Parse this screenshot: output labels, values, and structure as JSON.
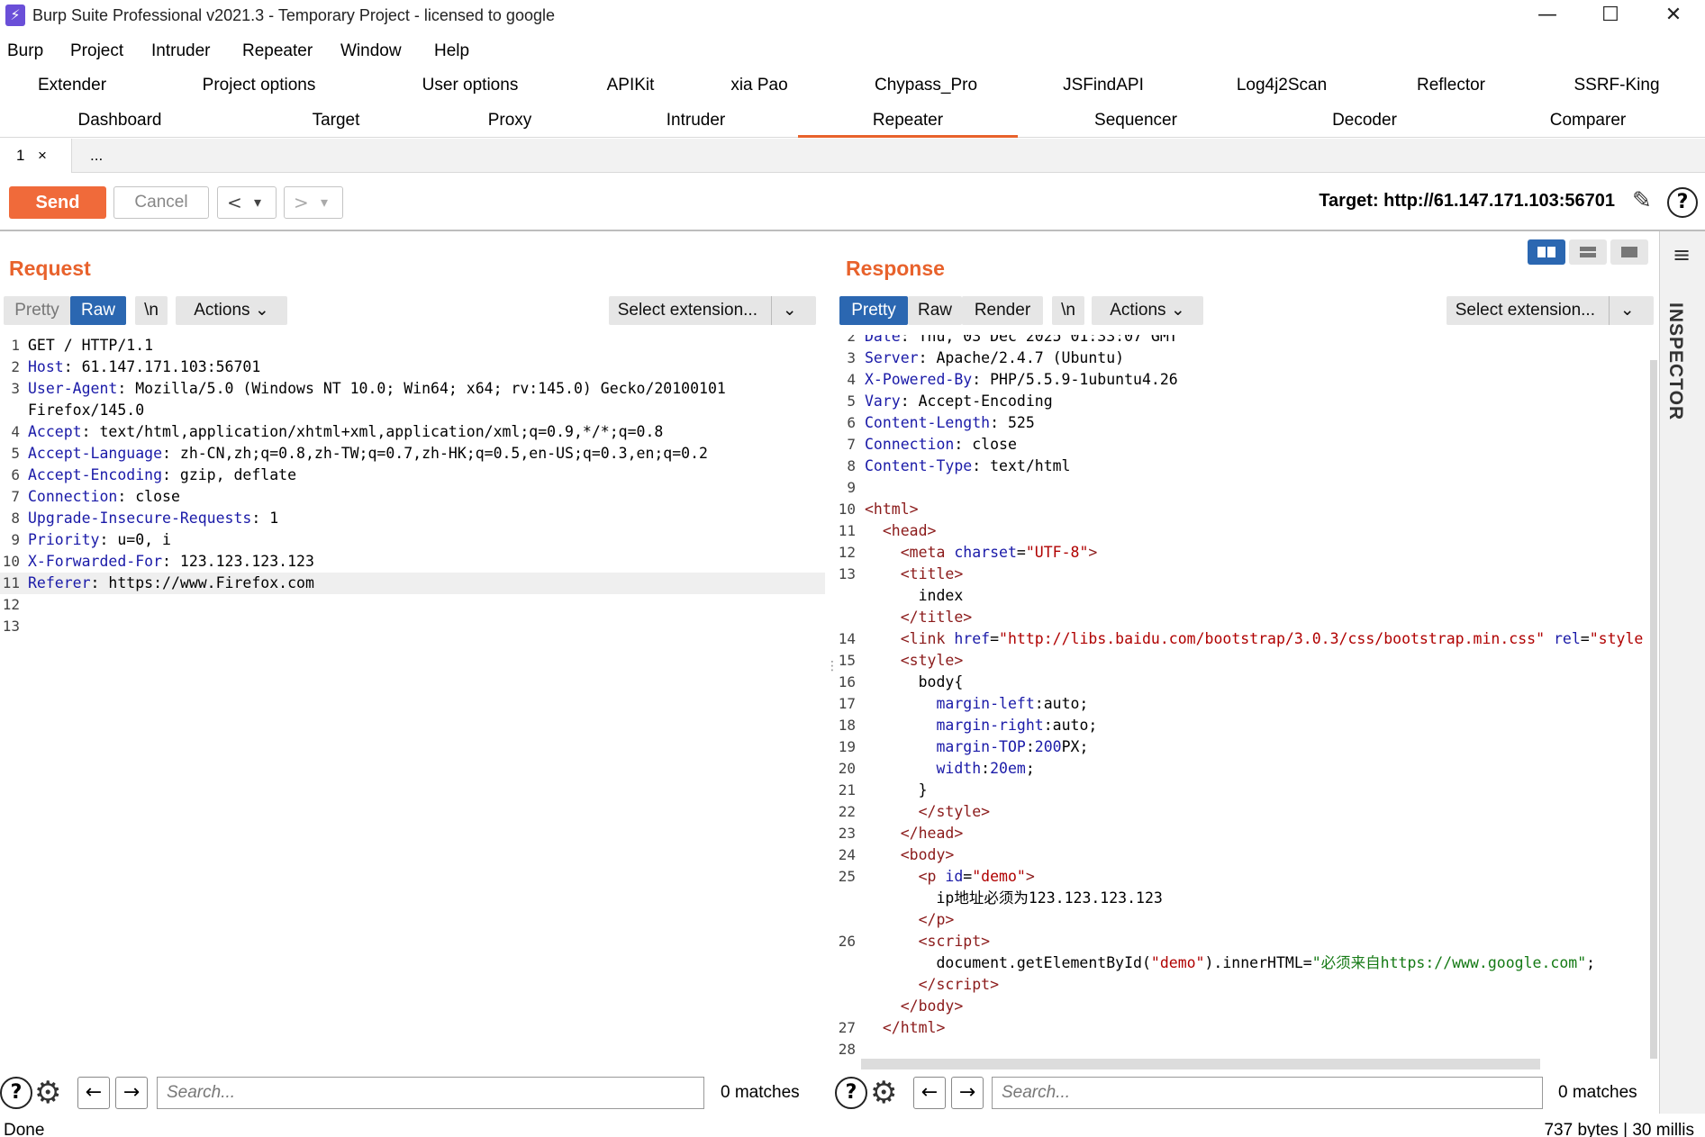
{
  "window": {
    "title": "Burp Suite Professional v2021.3 - Temporary Project - licensed to google",
    "minimize": "—",
    "maximize": "☐",
    "close": "✕"
  },
  "menu": [
    "Burp",
    "Project",
    "Intruder",
    "Repeater",
    "Window",
    "Help"
  ],
  "tabs_row1": [
    "Extender",
    "Project options",
    "User options",
    "APIKit",
    "xia Pao",
    "Chypass_Pro",
    "JSFindAPI",
    "Log4j2Scan",
    "Reflector",
    "SSRF-King"
  ],
  "tabs_row2": [
    "Dashboard",
    "Target",
    "Proxy",
    "Intruder",
    "Repeater",
    "Sequencer",
    "Decoder",
    "Comparer"
  ],
  "active_tab": "Repeater",
  "subtabs": {
    "first": "1",
    "close": "×",
    "more": "..."
  },
  "toolbar": {
    "send": "Send",
    "cancel": "Cancel",
    "back": "<",
    "forward": ">",
    "dropdown": "▾",
    "target": "Target: http://61.147.171.103:56701",
    "help": "?"
  },
  "request": {
    "title": "Request",
    "tools": {
      "pretty": "Pretty",
      "raw": "Raw",
      "newline": "\\n",
      "actions": "Actions",
      "select_ext": "Select extension..."
    },
    "lines": [
      {
        "n": "1",
        "k": "",
        "v": "GET / HTTP/1.1"
      },
      {
        "n": "2",
        "k": "Host",
        "v": ": 61.147.171.103:56701"
      },
      {
        "n": "3",
        "k": "User-Agent",
        "v": ": Mozilla/5.0 (Windows NT 10.0; Win64; x64; rv:145.0) Gecko/20100101"
      },
      {
        "n": "",
        "k": "",
        "v": "Firefox/145.0"
      },
      {
        "n": "4",
        "k": "Accept",
        "v": ": text/html,application/xhtml+xml,application/xml;q=0.9,*/*;q=0.8"
      },
      {
        "n": "5",
        "k": "Accept-Language",
        "v": ": zh-CN,zh;q=0.8,zh-TW;q=0.7,zh-HK;q=0.5,en-US;q=0.3,en;q=0.2"
      },
      {
        "n": "6",
        "k": "Accept-Encoding",
        "v": ": gzip, deflate"
      },
      {
        "n": "7",
        "k": "Connection",
        "v": ": close"
      },
      {
        "n": "8",
        "k": "Upgrade-Insecure-Requests",
        "v": ": 1"
      },
      {
        "n": "9",
        "k": "Priority",
        "v": ": u=0, i"
      },
      {
        "n": "10",
        "k": "X-Forwarded-For",
        "v": ": 123.123.123.123"
      },
      {
        "n": "11",
        "k": "Referer",
        "v": ": https://www.Firefox.com"
      },
      {
        "n": "12",
        "k": "",
        "v": ""
      },
      {
        "n": "13",
        "k": "",
        "v": ""
      }
    ],
    "search_placeholder": "Search...",
    "matches": "0 matches"
  },
  "response": {
    "title": "Response",
    "tools": {
      "pretty": "Pretty",
      "raw": "Raw",
      "render": "Render",
      "newline": "\\n",
      "actions": "Actions",
      "select_ext": "Select extension..."
    },
    "lines": [
      {
        "n": "2",
        "html": "<span class='hk'>Date</span>: Thu, 03 Dec 2025 01:33:07 GMT"
      },
      {
        "n": "3",
        "html": "<span class='hk'>Server</span>: Apache/2.4.7 (Ubuntu)"
      },
      {
        "n": "4",
        "html": "<span class='hk'>X-Powered-By</span>: PHP/5.5.9-1ubuntu4.26"
      },
      {
        "n": "5",
        "html": "<span class='hk'>Vary</span>: Accept-Encoding"
      },
      {
        "n": "6",
        "html": "<span class='hk'>Content-Length</span>: 525"
      },
      {
        "n": "7",
        "html": "<span class='hk'>Connection</span>: close"
      },
      {
        "n": "8",
        "html": "<span class='hk'>Content-Type</span>: text/html"
      },
      {
        "n": "9",
        "html": ""
      },
      {
        "n": "10",
        "html": "<span class='tg'>&lt;html&gt;</span>"
      },
      {
        "n": "11",
        "html": "  <span class='tg'>&lt;head&gt;</span>"
      },
      {
        "n": "12",
        "html": "    <span class='tg'>&lt;meta</span> <span class='at'>charset</span>=<span class='st'>\"UTF-8\"</span><span class='tg'>&gt;</span>"
      },
      {
        "n": "13",
        "html": "    <span class='tg'>&lt;title&gt;</span>"
      },
      {
        "n": "",
        "html": "      index"
      },
      {
        "n": "",
        "html": "    <span class='tg'>&lt;/title&gt;</span>"
      },
      {
        "n": "14",
        "html": "    <span class='tg'>&lt;link</span> <span class='at'>href</span>=<span class='st'>\"http://libs.baidu.com/bootstrap/3.0.3/css/bootstrap.min.css\"</span> <span class='at'>rel</span>=<span class='st'>\"style</span>"
      },
      {
        "n": "15",
        "html": "    <span class='tg'>&lt;style&gt;</span>"
      },
      {
        "n": "16",
        "html": "      body{"
      },
      {
        "n": "17",
        "html": "        <span class='hk'>margin-left</span>:auto;"
      },
      {
        "n": "18",
        "html": "        <span class='hk'>margin-right</span>:auto;"
      },
      {
        "n": "19",
        "html": "        <span class='hk'>margin-TOP</span>:<span class='hk'>200</span>PX;"
      },
      {
        "n": "20",
        "html": "        <span class='hk'>width</span>:<span class='hk'>20em</span>;"
      },
      {
        "n": "21",
        "html": "      }"
      },
      {
        "n": "22",
        "html": "      <span class='tg'>&lt;/style&gt;</span>"
      },
      {
        "n": "23",
        "html": "    <span class='tg'>&lt;/head&gt;</span>"
      },
      {
        "n": "24",
        "html": "    <span class='tg'>&lt;body&gt;</span>"
      },
      {
        "n": "25",
        "html": "      <span class='tg'>&lt;p</span> <span class='at'>id</span>=<span class='st'>\"demo\"</span><span class='tg'>&gt;</span>"
      },
      {
        "n": "",
        "html": "        ip地址必须为123.123.123.123"
      },
      {
        "n": "",
        "html": "      <span class='tg'>&lt;/p&gt;</span>"
      },
      {
        "n": "26",
        "html": "      <span class='tg'>&lt;script&gt;</span>"
      },
      {
        "n": "",
        "html": "        document.getElementById(<span class='st'>\"demo\"</span>).innerHTML=<span class='gn'>\"必须来自https://www.google.com\"</span>;"
      },
      {
        "n": "",
        "html": "      <span class='tg'>&lt;/script&gt;</span>"
      },
      {
        "n": "",
        "html": "    <span class='tg'>&lt;/body&gt;</span>"
      },
      {
        "n": "27",
        "html": "  <span class='tg'>&lt;/html&gt;</span>"
      },
      {
        "n": "28",
        "html": ""
      }
    ],
    "search_placeholder": "Search...",
    "matches": "0 matches"
  },
  "inspector": "INSPECTOR",
  "status": {
    "left": "Done",
    "right": "737 bytes | 30 millis"
  },
  "colors": {
    "accent": "#e8622c",
    "active_tool": "#2b67b1",
    "send": "#f06a3a"
  }
}
